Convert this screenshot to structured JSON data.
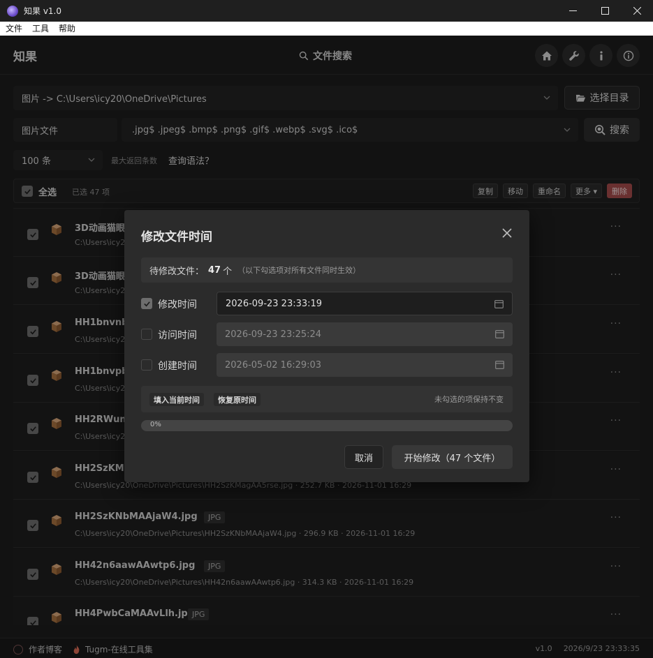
{
  "window": {
    "title": "知果 v1.0",
    "controls": [
      "minimize-icon",
      "maximize-icon",
      "close-icon"
    ]
  },
  "menubar": {
    "items": [
      "文件",
      "工具",
      "帮助"
    ]
  },
  "header": {
    "brand": "知果",
    "search_label": "文件搜索",
    "icons": [
      "home-icon",
      "wrench-icon",
      "info-icon",
      "about-icon"
    ]
  },
  "path": {
    "value": "图片 -> C:\\Users\\icy20\\OneDrive\\Pictures",
    "choose_dir_label": "选择目录"
  },
  "filter": {
    "type_label": "图片文件",
    "pattern": ".jpg$ .jpeg$ .bmp$ .png$ .gif$ .webp$ .svg$ .ico$",
    "search_label": "搜索"
  },
  "limit": {
    "value": "100 条",
    "hint": "最大返回条数",
    "syntax_link": "查询语法？"
  },
  "toolbar": {
    "select_all": "全选",
    "selected_count": "已选 47 项",
    "actions": {
      "copy": "复制",
      "move": "移动",
      "rename": "重命名",
      "more": "更多 ▾",
      "delete": "删除"
    }
  },
  "files": [
    {
      "name": "3D动画猫眼",
      "ext": "",
      "meta": "C:\\Users\\icy20"
    },
    {
      "name": "3D动画猫眼",
      "ext": "",
      "meta": "C:\\Users\\icy20"
    },
    {
      "name": "HH1bnvnbM",
      "ext": "",
      "meta": "C:\\Users\\icy20"
    },
    {
      "name": "HH1bnvpbA",
      "ext": "",
      "meta": "C:\\Users\\icy20"
    },
    {
      "name": "HH2RWunl",
      "ext": "",
      "meta": "C:\\Users\\icy20"
    },
    {
      "name": "HH2SzKMa",
      "ext": "",
      "meta": "C:\\Users\\icy20\\OneDrive\\Pictures\\HH2SzKMagAA5rse.jpg · 252.7 KB · 2026-11-01 16:29"
    },
    {
      "name": "HH2SzKNbMAAjaW4.jpg",
      "ext": "JPG",
      "meta": "C:\\Users\\icy20\\OneDrive\\Pictures\\HH2SzKNbMAAjaW4.jpg · 296.9 KB · 2026-11-01 16:29"
    },
    {
      "name": "HH42n6aawAAwtp6.jpg",
      "ext": "JPG",
      "meta": "C:\\Users\\icy20\\OneDrive\\Pictures\\HH42n6aawAAwtp6.jpg · 314.3 KB · 2026-11-01 16:29"
    },
    {
      "name": "HH4PwbCaMAAvLlh.jpg",
      "ext": "JPG",
      "meta": ""
    }
  ],
  "statusbar": {
    "blog": "作者博客",
    "tools": "Tugm-在线工具集",
    "version": "v1.0",
    "datetime": "2026/9/23 23:33:35"
  },
  "modal": {
    "title": "修改文件时间",
    "pending_label": "待修改文件：",
    "pending_count": "47",
    "pending_unit": "个",
    "pending_note": "（以下勾选项对所有文件同时生效）",
    "rows": [
      {
        "label": "修改时间",
        "value": "2026-09-23 23:33:19",
        "checked": true
      },
      {
        "label": "访问时间",
        "value": "2026-09-23 23:25:24",
        "checked": false
      },
      {
        "label": "创建时间",
        "value": "2026-05-02 16:29:03",
        "checked": false
      }
    ],
    "fill_now_label": "填入当前时间",
    "restore_label": "恢复原时间",
    "unchecked_note": "未勾选的项保持不变",
    "progress_text": "0%",
    "progress_value": 0,
    "cancel_label": "取消",
    "start_label": "开始修改（47 个文件）"
  }
}
